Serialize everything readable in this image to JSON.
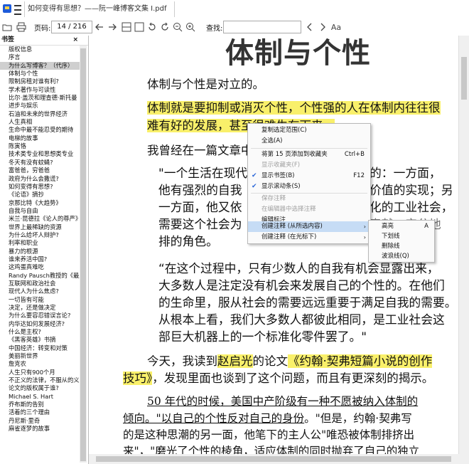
{
  "window": {
    "title": "如何变得有思想？——阮一峰博客文集 Ⅰ.pdf"
  },
  "toolbar": {
    "page_label": "页码:",
    "page_value": "14 / 216",
    "find_label": "查找:"
  },
  "sidebar": {
    "header": "书签",
    "items": [
      {
        "label": "版权信息"
      },
      {
        "label": "序言"
      },
      {
        "label": "为什么写博客？（代序）",
        "selected": true
      },
      {
        "label": "体制与个性"
      },
      {
        "label": "限制房租对谁有利?"
      },
      {
        "label": "学术著作与可读性"
      },
      {
        "label": "比尔·盖茨和理查德·斯托曼"
      },
      {
        "label": "进步与娱乐"
      },
      {
        "label": "石油和未来的世界经济"
      },
      {
        "label": "人生真相"
      },
      {
        "label": "生命中最不能忍受的期待"
      },
      {
        "label": "电梯的故事"
      },
      {
        "label": "陈寅恪"
      },
      {
        "label": "技术类专业和思想类专业"
      },
      {
        "label": "冬天有没有蚊蝇?"
      },
      {
        "label": "富爸爸，穷爸爸"
      },
      {
        "label": "政府为什么会撒谎?"
      },
      {
        "label": "如何变得有思想?"
      },
      {
        "label": "《论语》摘抄"
      },
      {
        "label": "京那比特《大趋势》"
      },
      {
        "label": "自我与自由"
      },
      {
        "label": "米兰·昆德拉《论人的尊严》"
      },
      {
        "label": "世界上最稀缺的资源"
      },
      {
        "label": "为什么给坏人辩护?"
      },
      {
        "label": "利率和职业"
      },
      {
        "label": "暴力的根源"
      },
      {
        "label": "谁来养活中国?"
      },
      {
        "label": "这鸡蛋真难吃"
      },
      {
        "label": "Randy Pausch教授的《最后一课》"
      },
      {
        "label": "互联网和政治社会"
      },
      {
        "label": "现代人为什么焦虑?"
      },
      {
        "label": "一切皆有可能"
      },
      {
        "label": "决定，还是做决定"
      },
      {
        "label": "为什么要容忍错误言论?"
      },
      {
        "label": "内华达如何发展经济?"
      },
      {
        "label": "什么是主权?"
      },
      {
        "label": "《黑客英雄》书摘"
      },
      {
        "label": "中国经济：转变和对策"
      },
      {
        "label": "美丽新世界"
      },
      {
        "label": "詹克农"
      },
      {
        "label": "人生只有900个月"
      },
      {
        "label": "不正义的法律，不服从的义务"
      },
      {
        "label": "论文的版权属于谁?"
      },
      {
        "label": "Michael S. Hart"
      },
      {
        "label": "乔布斯的告别"
      },
      {
        "label": "活着的三个理由"
      },
      {
        "label": "丹尼斯·里奇"
      },
      {
        "label": "麻雀逐梦的故事"
      }
    ]
  },
  "doc": {
    "heading": "体制与个性",
    "p1": "体制与个性是对立的。",
    "p2_line1": "体制就是要抑制或消灭个性，个性强的人在体制内往往很",
    "p2_line2": "难有好的发展，甚至很难生存下来。",
    "p3": "我曾经在一篇文章中",
    "q1_line1": "\"一个生活在现代",
    "q1_line1_tail": "的：一方面，",
    "q1_line2": "他有强烈的自我",
    "q1_line2_tail": "价值的实现；另",
    "q1_line3": "一方面，他又依",
    "q1_line3_tail": "化的工业社会，",
    "q1_line4": "需要这个社会为",
    "q1_line4_tail": "奉献，安分地",
    "q1_line5": "排的角色。",
    "q2_line1": "“在这个过程中，只有少数人的自我有机会显露出来，",
    "q2_line2": "大多数人是注定没有机会来发展自己的个性的。在他们",
    "q2_line3": "的生命里，服从社会的需要远远重要于满足自我的需要。",
    "q2_line4": "从根本上看，我们大多数人都彼此相同，是工业社会这",
    "q2_line5": "部巨大机器上的一个标准化零件罢了。\"",
    "p4_a": "今天，我读到",
    "p4_name": "赵启光",
    "p4_b": "的论文",
    "p4_title1": "《约翰·契弗短篇小说的创作",
    "p4_title2": "技巧》",
    "p4_c": "，发现里面也谈到了这个问题，而且有更深刻的揭示。",
    "p5_line1": "50 年代的时候，美国中产阶级有一种不愿被纳入体制的",
    "p5_line2a": "倾向。\"以自己的个性反对自己的身份",
    "p5_line2b": "。\"但是，约翰·契弗写",
    "p5_line3": "的是这种思潮的另一面，他笔下的主人公\"唯恐被体制排挤出",
    "p5_line4": "来\"，\"磨光了个性的棱角，适应体制的同时抛弃了自己的独立"
  },
  "context_menu": {
    "items": [
      {
        "label": "复制选定范围(C)"
      },
      {
        "label": "全选(A)"
      },
      {
        "label": "将第 15 页添加到收藏夹",
        "shortcut": "Ctrl+B"
      },
      {
        "label": "显示收藏夹(F)",
        "disabled": true
      },
      {
        "label": "显示书签(B)",
        "shortcut": "F12",
        "checked": true
      },
      {
        "label": "显示滚动条(S)",
        "checked": true
      },
      {
        "label": "保存注释",
        "disabled": true
      },
      {
        "label": "在编辑器中选择注释",
        "disabled": true
      },
      {
        "label": "编辑标注"
      },
      {
        "label": "创建注释 (从所选内容)",
        "submenu": true,
        "hover": true
      },
      {
        "label": "创建注释 (在光标下)",
        "submenu": true
      }
    ]
  },
  "submenu": {
    "items": [
      {
        "label": "高亮",
        "shortcut": "A"
      },
      {
        "label": "下划线"
      },
      {
        "label": "删除线"
      },
      {
        "label": "波浪线(Q)"
      }
    ]
  }
}
